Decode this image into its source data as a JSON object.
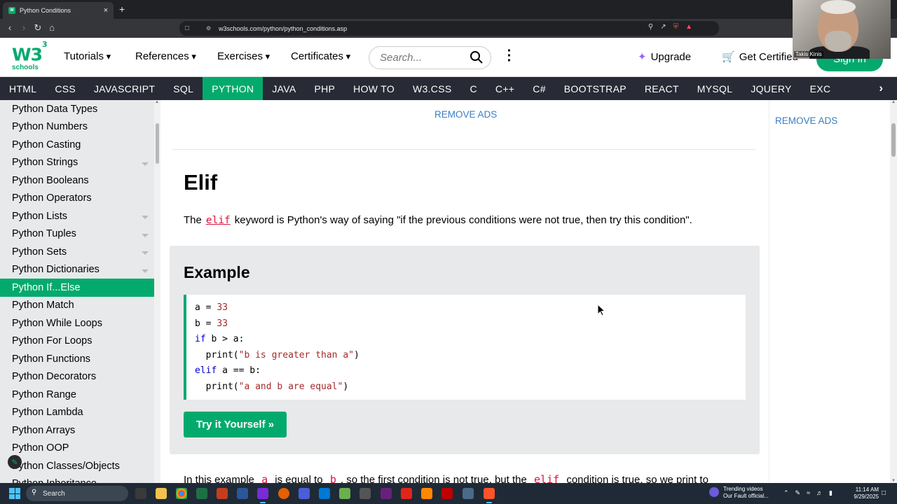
{
  "browser": {
    "tab_title": "Python Conditions",
    "tab_close": "×",
    "new_tab": "+",
    "url": "w3schools.com/python/python_conditions.asp"
  },
  "webcam": {
    "name": "Takis Kinis"
  },
  "header": {
    "logo_w3": "W3",
    "logo_schools": "schools",
    "menus": [
      "Tutorials",
      "References",
      "Exercises",
      "Certificates"
    ],
    "search_placeholder": "Search...",
    "upgrade": "Upgrade",
    "get_certified": "Get Certified",
    "sign_in": "Sign In"
  },
  "topnav": {
    "items": [
      "HTML",
      "CSS",
      "JAVASCRIPT",
      "SQL",
      "PYTHON",
      "JAVA",
      "PHP",
      "HOW TO",
      "W3.CSS",
      "C",
      "C++",
      "C#",
      "BOOTSTRAP",
      "REACT",
      "MYSQL",
      "JQUERY",
      "EXC"
    ],
    "active": "PYTHON"
  },
  "sidebar": {
    "items": [
      {
        "label": "Python Data Types",
        "caret": false
      },
      {
        "label": "Python Numbers",
        "caret": false
      },
      {
        "label": "Python Casting",
        "caret": false
      },
      {
        "label": "Python Strings",
        "caret": true
      },
      {
        "label": "Python Booleans",
        "caret": false
      },
      {
        "label": "Python Operators",
        "caret": false
      },
      {
        "label": "Python Lists",
        "caret": true
      },
      {
        "label": "Python Tuples",
        "caret": true
      },
      {
        "label": "Python Sets",
        "caret": true
      },
      {
        "label": "Python Dictionaries",
        "caret": true
      },
      {
        "label": "Python If...Else",
        "caret": false,
        "active": true
      },
      {
        "label": "Python Match",
        "caret": false
      },
      {
        "label": "Python While Loops",
        "caret": false
      },
      {
        "label": "Python For Loops",
        "caret": false
      },
      {
        "label": "Python Functions",
        "caret": false
      },
      {
        "label": "Python Decorators",
        "caret": false
      },
      {
        "label": "Python Range",
        "caret": false
      },
      {
        "label": "Python Lambda",
        "caret": false
      },
      {
        "label": "Python Arrays",
        "caret": false
      },
      {
        "label": "Python OOP",
        "caret": false
      },
      {
        "label": "Python Classes/Objects",
        "caret": false
      },
      {
        "label": "Python Inheritance",
        "caret": false
      }
    ]
  },
  "main": {
    "remove_ads": "REMOVE ADS",
    "heading": "Elif",
    "intro_before": "The",
    "intro_keyword": "elif",
    "intro_after": "keyword is Python's way of saying \"if the previous conditions were not true, then try this condition\".",
    "example_title": "Example",
    "code_lines": [
      "a = 33",
      "b = 33",
      "if b > a:",
      "  print(\"b is greater than a\")",
      "elif a == b:",
      "  print(\"a and b are equal\")"
    ],
    "try_button": "Try it Yourself »",
    "para2_a": "In this example",
    "para2_var_a": "a",
    "para2_b": "is equal to",
    "para2_var_b": "b",
    "para2_c": ", so the first condition is not true, but the",
    "para2_elif": "elif",
    "para2_d": "condition is true, so we print to"
  },
  "right": {
    "remove_ads": "REMOVE ADS"
  },
  "taskbar": {
    "search": "Search",
    "trending_title": "Trending videos",
    "trending_sub": "Our Fault official...",
    "time": "11:14 AM",
    "date": "9/29/2025"
  },
  "colors": {
    "brand_green": "#04aa6d",
    "nav_dark": "#282a35",
    "sidebar_bg": "#e7e9eb",
    "link_blue": "#3a7ec2",
    "keyword_red": "#dc143c"
  }
}
